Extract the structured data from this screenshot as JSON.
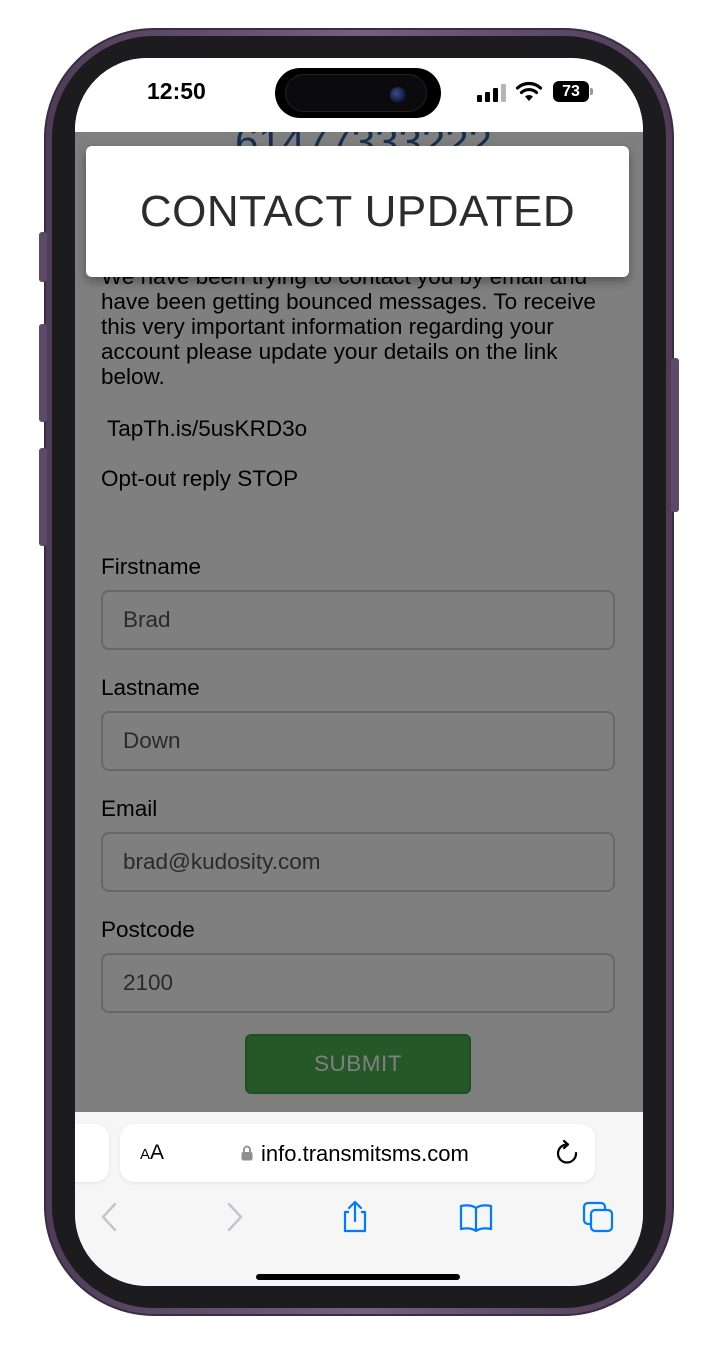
{
  "status_bar": {
    "time": "12:50",
    "battery": "73"
  },
  "page": {
    "sender_number": "61477333222",
    "message": "We have been trying to contact you by email and have been getting bounced messages. To receive this very important information regarding your account please update your details on the link below.",
    "short_link": "TapTh.is/5usKRD3o",
    "optout": "Opt-out reply STOP",
    "form": {
      "firstname_label": "Firstname",
      "firstname_value": "Brad",
      "lastname_label": "Lastname",
      "lastname_value": "Down",
      "email_label": "Email",
      "email_value": "brad@kudosity.com",
      "postcode_label": "Postcode",
      "postcode_value": "2100",
      "submit_label": "SUBMIT"
    }
  },
  "toast": {
    "message": "CONTACT UPDATED"
  },
  "browser": {
    "aa_small": "A",
    "aa_large": "A",
    "url": "info.transmitsms.com"
  },
  "colors": {
    "link_blue": "#2b5fa0",
    "submit_green": "#4caf50",
    "ios_blue": "#007aff",
    "frame_purple": "#5d4a66"
  },
  "icons": [
    "lock-icon",
    "reload-icon",
    "back-icon",
    "forward-icon",
    "share-icon",
    "bookmarks-icon",
    "tabs-icon",
    "signal-icon",
    "wifi-icon",
    "battery-icon"
  ]
}
